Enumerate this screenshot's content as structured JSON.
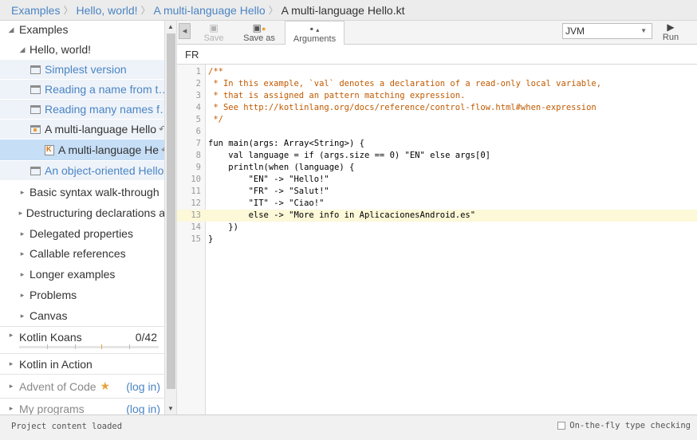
{
  "breadcrumb": [
    "Examples",
    "Hello, world!",
    "A multi-language Hello",
    "A multi-language Hello.kt"
  ],
  "sidebar": {
    "root": "Examples",
    "group": "Hello, world!",
    "items": [
      "Simplest version",
      "Reading a name from t…",
      "Reading many names f…",
      "A multi-language Hello",
      "A multi-language He",
      "An object-oriented Hello"
    ],
    "sections": [
      "Basic syntax walk-through",
      "Destructuring declarations a",
      "Delegated properties",
      "Callable references",
      "Longer examples",
      "Problems",
      "Canvas"
    ],
    "koans": {
      "label": "Kotlin Koans",
      "count": "0/42",
      "progress": 0
    },
    "kotlin_in_action": "Kotlin in Action",
    "advent": {
      "label": "Advent of Code",
      "star": "★",
      "login": "(log in)"
    },
    "my_programs": {
      "label": "My programs",
      "login": "(log in)"
    }
  },
  "toolbar": {
    "save": "Save",
    "save_as": "Save as",
    "arguments": "Arguments",
    "target": "JVM",
    "run": "Run"
  },
  "arguments_value": "FR",
  "code_lines": [
    {
      "n": "1",
      "text": "/**",
      "type": "comment"
    },
    {
      "n": "2",
      "text": " * In this example, `val` denotes a declaration of a read-only local variable,",
      "type": "comment"
    },
    {
      "n": "3",
      "text": " * that is assigned an pattern matching expression.",
      "type": "comment"
    },
    {
      "n": "4",
      "text": " * See http://kotlinlang.org/docs/reference/control-flow.html#when-expression",
      "type": "comment"
    },
    {
      "n": "5",
      "text": " */",
      "type": "comment"
    },
    {
      "n": "6",
      "text": "",
      "type": "code"
    },
    {
      "n": "7",
      "text": "fun main(args: Array<String>) {",
      "type": "code"
    },
    {
      "n": "8",
      "text": "    val language = if (args.size == 0) \"EN\" else args[0]",
      "type": "code"
    },
    {
      "n": "9",
      "text": "    println(when (language) {",
      "type": "code"
    },
    {
      "n": "10",
      "text": "        \"EN\" -> \"Hello!\"",
      "type": "code"
    },
    {
      "n": "11",
      "text": "        \"FR\" -> \"Salut!\"",
      "type": "code"
    },
    {
      "n": "12",
      "text": "        \"IT\" -> \"Ciao!\"",
      "type": "code"
    },
    {
      "n": "13",
      "text": "        else -> \"More info in AplicacionesAndroid.es\"",
      "type": "code",
      "highlight": true
    },
    {
      "n": "14",
      "text": "    })",
      "type": "code"
    },
    {
      "n": "15",
      "text": "}",
      "type": "code"
    }
  ],
  "status": {
    "message": "Project content loaded",
    "type_checking": "On-the-fly type checking"
  }
}
